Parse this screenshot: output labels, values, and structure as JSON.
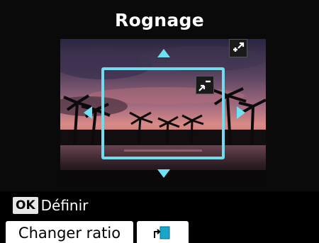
{
  "screen": {
    "title": "Rognage"
  },
  "preview": {
    "image_subject": "sunset over palm trees reflected in water"
  },
  "icons": {
    "zoom_in": "expand-icon",
    "zoom_out": "shrink-icon",
    "move_up": "triangle-up-icon",
    "move_down": "triangle-down-icon",
    "move_left": "triangle-left-icon",
    "move_right": "triangle-right-icon",
    "rotate_frame": "rotate-frame-icon"
  },
  "colors": {
    "accent": "#73dbee",
    "background": "#0a0a0a",
    "button_bg": "#ffffff"
  },
  "footer": {
    "ok_key": "OK",
    "ok_label": "Définir",
    "change_ratio_label": "Changer ratio"
  }
}
